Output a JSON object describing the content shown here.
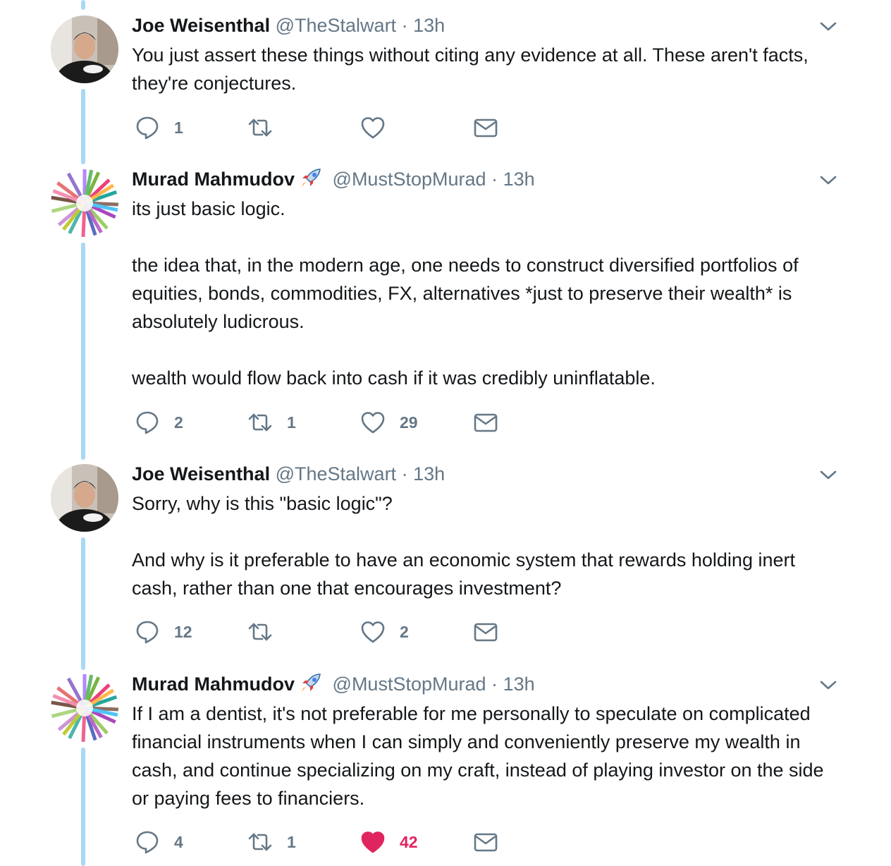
{
  "colors": {
    "thread_line": "#a9d8f5",
    "icon_gray": "#657786",
    "like_red": "#e0245e"
  },
  "icons": {
    "reply": "reply-icon",
    "retweet": "retweet-icon",
    "like": "heart-icon",
    "dm": "envelope-icon",
    "caret": "chevron-down-icon",
    "rocket": "rocket-emoji"
  },
  "tweets": [
    {
      "name": "Joe Weisenthal",
      "handle": "@TheStalwart",
      "dot": "·",
      "time": "13h",
      "paragraphs": [
        "You just assert these things without citing any evidence at all. These aren't facts, they're conjectures."
      ],
      "replies": "1",
      "retweets": "",
      "likes": "",
      "liked": false
    },
    {
      "name": "Murad Mahmudov",
      "handle": "@MustStopMurad",
      "dot": "·",
      "time": "13h",
      "paragraphs": [
        "its just basic logic.",
        "the idea that, in the modern age, one needs to construct diversified portfolios of equities, bonds, commodities, FX, alternatives *just to preserve their wealth* is absolutely ludicrous.",
        "wealth would flow back into cash if it was credibly uninflatable."
      ],
      "replies": "2",
      "retweets": "1",
      "likes": "29",
      "liked": false
    },
    {
      "name": "Joe Weisenthal",
      "handle": "@TheStalwart",
      "dot": "·",
      "time": "13h",
      "paragraphs": [
        "Sorry, why is this \"basic logic\"?",
        "And why is it preferable to have an economic system that rewards holding inert cash, rather than one that encourages investment?"
      ],
      "replies": "12",
      "retweets": "",
      "likes": "2",
      "liked": false
    },
    {
      "name": "Murad Mahmudov",
      "handle": "@MustStopMurad",
      "dot": "·",
      "time": "13h",
      "paragraphs": [
        "If I am a dentist, it's not preferable for me personally to speculate on complicated financial instruments when I can simply and conveniently preserve my wealth in cash, and continue specializing on my craft, instead of playing investor on the side or paying fees to financiers."
      ],
      "replies": "4",
      "retweets": "1",
      "likes": "42",
      "liked": true
    }
  ]
}
